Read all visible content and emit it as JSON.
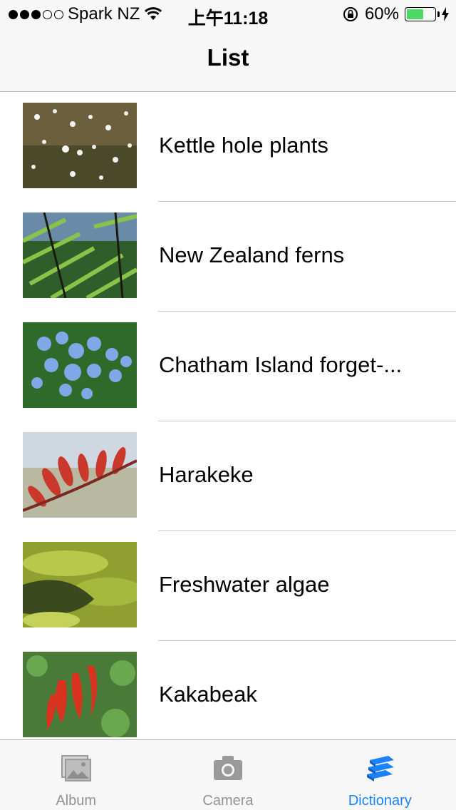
{
  "status_bar": {
    "carrier": "Spark NZ",
    "time": "上午11:18",
    "battery_percent": "60%",
    "battery_level": 0.6,
    "signal_bars_filled": 3,
    "signal_bars_total": 5
  },
  "nav": {
    "title": "List"
  },
  "items": [
    {
      "label": "Kettle hole plants",
      "thumb_icon": "white-flowers-photo"
    },
    {
      "label": "New Zealand ferns",
      "thumb_icon": "fern-photo"
    },
    {
      "label": "Chatham Island forget-...",
      "thumb_icon": "blue-flowers-photo"
    },
    {
      "label": "Harakeke",
      "thumb_icon": "red-flax-flower-photo"
    },
    {
      "label": "Freshwater algae",
      "thumb_icon": "green-algae-photo"
    },
    {
      "label": "Kakabeak",
      "thumb_icon": "red-kakabeak-flower-photo"
    }
  ],
  "tabs": [
    {
      "label": "Album",
      "icon": "photo-album-icon",
      "active": false
    },
    {
      "label": "Camera",
      "icon": "camera-icon",
      "active": false
    },
    {
      "label": "Dictionary",
      "icon": "books-icon",
      "active": true
    }
  ],
  "colors": {
    "accent": "#1a82fb",
    "battery": "#4cd964",
    "inactive": "#929292"
  }
}
